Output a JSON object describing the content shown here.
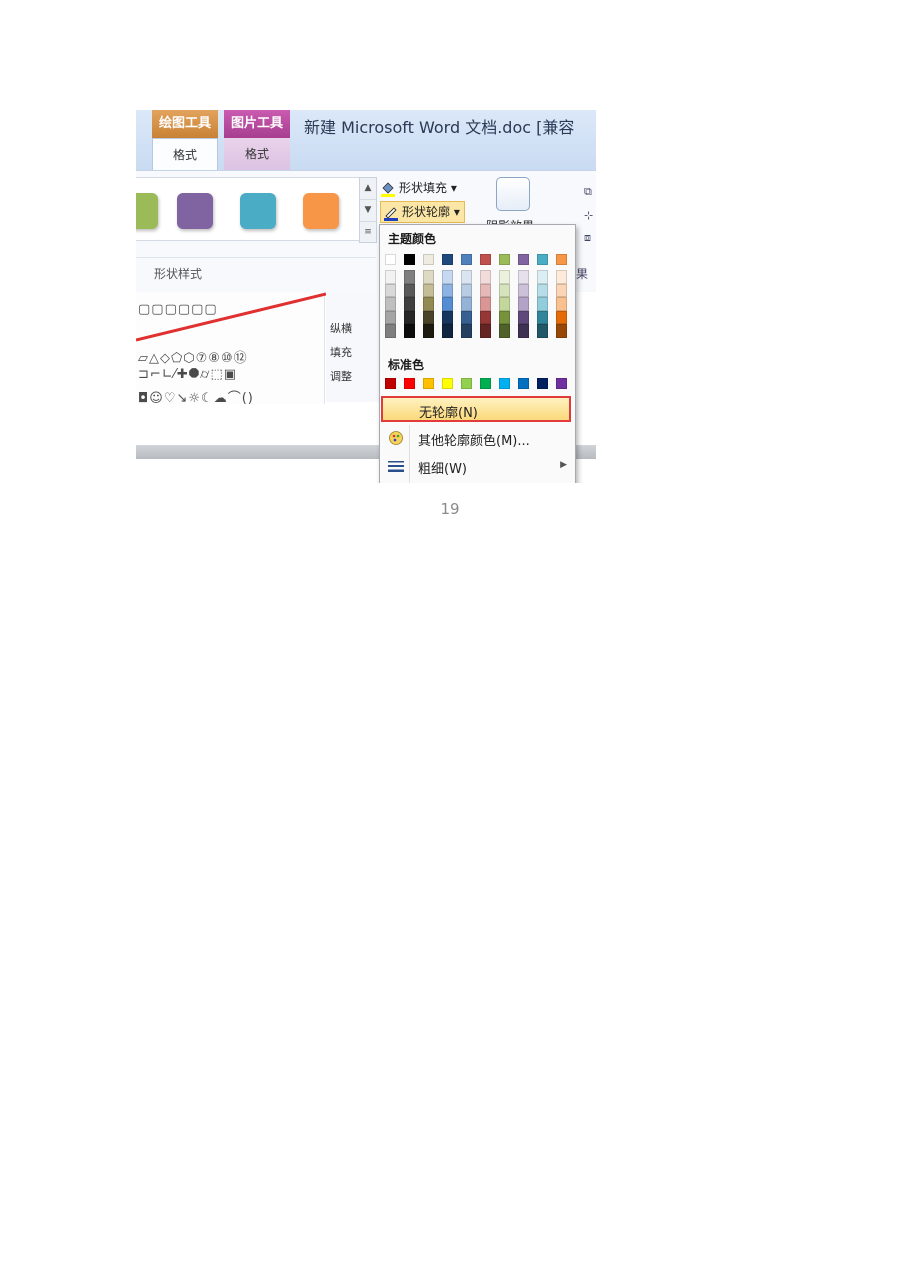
{
  "ribbon": {
    "contextual_tabs": [
      {
        "group": "绘图工具",
        "tab": "格式"
      },
      {
        "group": "图片工具",
        "tab": "格式"
      }
    ],
    "window_title": "新建 Microsoft Word 文档.doc [兼容",
    "shape_style_swatches": [
      "#9bbb59",
      "#8064a2",
      "#4bacc6",
      "#f79646"
    ],
    "group_label": "形状样式",
    "shape_fill_label": "形状填充",
    "shape_outline_label": "形状轮廓",
    "shadow_effect_label": "阴影效果",
    "right_partial_label": "果"
  },
  "side_panel": {
    "items": [
      "纵横",
      "填充",
      "调整"
    ]
  },
  "outline_menu": {
    "theme_colors_heading": "主题颜色",
    "theme_colors": [
      [
        "#ffffff",
        "#f2f2f2",
        "#d8d8d8",
        "#bfbfbf",
        "#a5a5a5",
        "#7f7f7f"
      ],
      [
        "#000000",
        "#7f7f7f",
        "#595959",
        "#3f3f3f",
        "#262626",
        "#0c0c0c"
      ],
      [
        "#eeece1",
        "#ddd9c3",
        "#c4bd97",
        "#938953",
        "#494429",
        "#1d1b10"
      ],
      [
        "#1f497d",
        "#c6d9f0",
        "#8db3e2",
        "#548dd4",
        "#17365d",
        "#0f243e"
      ],
      [
        "#4f81bd",
        "#dbe5f1",
        "#b8cce4",
        "#95b3d7",
        "#366092",
        "#244061"
      ],
      [
        "#c0504d",
        "#f2dcdb",
        "#e5b9b7",
        "#d99694",
        "#953734",
        "#632423"
      ],
      [
        "#9bbb59",
        "#ebf1dd",
        "#d7e3bc",
        "#c3d69b",
        "#76923c",
        "#4f6128"
      ],
      [
        "#8064a2",
        "#e5e0ec",
        "#ccc1d9",
        "#b2a2c7",
        "#5f497a",
        "#3f3151"
      ],
      [
        "#4bacc6",
        "#dbeef3",
        "#b7dde8",
        "#92cddc",
        "#31859b",
        "#205867"
      ],
      [
        "#f79646",
        "#fdeada",
        "#fbd5b5",
        "#fac08f",
        "#e36c09",
        "#974806"
      ]
    ],
    "standard_colors_heading": "标准色",
    "standard_colors": [
      "#c00000",
      "#ff0000",
      "#ffc000",
      "#ffff00",
      "#92d050",
      "#00b050",
      "#00b0f0",
      "#0070c0",
      "#002060",
      "#7030a0"
    ],
    "no_outline_label": "无轮廓(N)",
    "more_colors_label": "其他轮廓颜色(M)...",
    "weight_label": "粗细(W)"
  },
  "page": {
    "page_number": "19"
  }
}
